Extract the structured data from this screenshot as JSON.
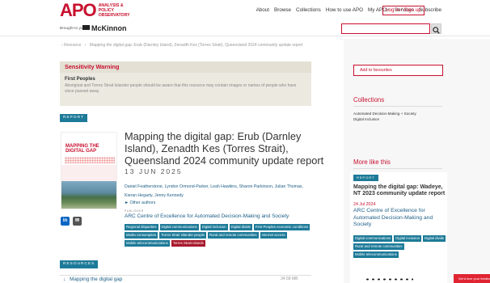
{
  "header": {
    "logo_text": "APO",
    "logo_subtitle": "ANALYSIS & POLICY OBSERVATORY",
    "nav": [
      "About",
      "Browse",
      "Collections",
      "How to use APO",
      "My APO+",
      "Services",
      "Subscribe"
    ],
    "login_label": "Log in / Sign up"
  },
  "sponsor": {
    "brought_text": "Brought to you by",
    "brand": "McKinnon"
  },
  "search": {
    "placeholder": ""
  },
  "breadcrumb": {
    "home": "Resource",
    "current": "Mapping the digital gap: Erub (Darnley Island), Zenadth Kes (Torres Strait), Queensland 2024 community update report"
  },
  "sensitivity": {
    "heading": "Sensitivity Warning",
    "title": "First Peoples",
    "text": "Aboriginal and Torres Strait Islander people should be aware that this resource may contain images or names of people who have since passed away."
  },
  "report": {
    "tag": "REPORT",
    "thumbnail_title": "MAPPING THE DIGITAL GAP",
    "title": "Mapping the digital gap: Erub (Darnley Island), Zenadth Kes (Torres Strait), Queensland 2024 community update report",
    "date": "13 JUN 2025",
    "authors": "Daniel Featherstone, Lyndon Ormond-Parker, Leah Hawkins, Sharon Parkinson, Julian Thomas, Kieran Hegarty, Jenny Kennedy",
    "other_authors": "► Other authors",
    "publisher_label": "PUBLISHER",
    "publisher": "ARC Centre of Excellence for Automated Decision-Making and Society",
    "tags": [
      {
        "label": "Regional disparities",
        "red": false
      },
      {
        "label": "Digital communications",
        "red": false
      },
      {
        "label": "Digital inclusion",
        "red": false
      },
      {
        "label": "Digital divide",
        "red": false
      },
      {
        "label": "First Peoples economic conditions",
        "red": false
      },
      {
        "label": "Media consumption",
        "red": false
      },
      {
        "label": "Torres Strait Islander people",
        "red": false
      },
      {
        "label": "Rural and remote communities",
        "red": false
      },
      {
        "label": "Internet access",
        "red": false
      },
      {
        "label": "Mobile telecommunications",
        "red": false
      },
      {
        "label": "Torres Strait Islands",
        "red": true
      }
    ]
  },
  "share": {
    "linkedin": "in",
    "email": "✉"
  },
  "resources": {
    "tag": "RESOURCES",
    "file_label": "Mapping the digital gap",
    "file_size": "34.58 MB"
  },
  "sidebar": {
    "fav_label": "Add to favourites",
    "collections_heading": "Collections",
    "collections": [
      "Automated Decision-Making + Society",
      "Digital Inclusion"
    ],
    "more_heading": "More like this",
    "card": {
      "tag": "REPORT",
      "title": "Mapping the digital gap: Wadeye, NT 2023 community update report",
      "date": "24 Jul 2024",
      "publisher": "ARC Centre of Excellence for Automated Decision-Making and Society",
      "tags": [
        "Digital communications",
        "Digital inclusion",
        "Digital divide",
        "Rural and remote communities",
        "Mobile telecommunications"
      ]
    }
  },
  "feedback": {
    "label": "We'd love your feedback"
  },
  "colors": {
    "brand_red": "#c8102e",
    "teal": "#1d7a98",
    "link": "#1d5e87"
  }
}
